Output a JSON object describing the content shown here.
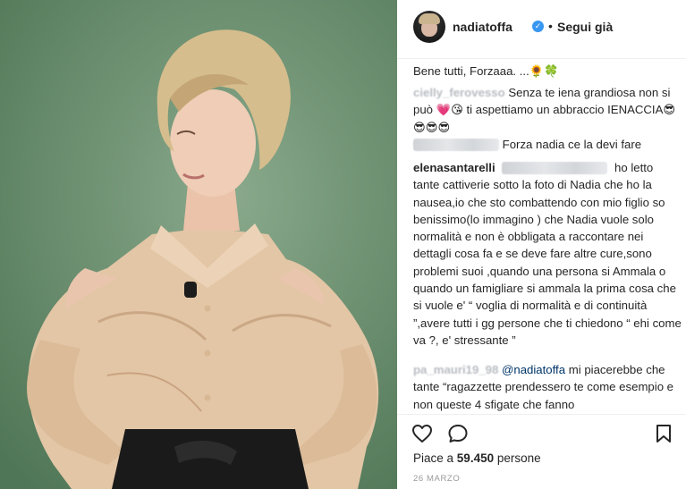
{
  "header": {
    "username": "nadiatoffa",
    "verified_glyph": "✓",
    "separator": "•",
    "follow_label": "Segui già"
  },
  "comments": [
    {
      "text": "Bene tutti, Forzaaa. ...🌻🍀"
    },
    {
      "user_hidden": "cielly_ferovesso",
      "text": "Senza te iena grandiosa non si può 💗😘 ti aspettiamo un abbraccio IENACCIA😎😎😎😎"
    },
    {
      "text": "Forza nadia ce la devi fare"
    },
    {
      "user": "elenasantarelli",
      "text": "ho letto tante cattiverie sotto la foto di Nadia che ho la nausea,io che sto combattendo con mio figlio so benissimo(lo immagino ) che Nadia vuole solo normalità e non è obbligata a raccontare nei dettagli cosa fa e se deve fare altre cure,sono problemi suoi ,quando una persona si Ammala o quando un famigliare si ammala la prima cosa che si vuole e' “ voglia di normalità e di continuità ”,avere tutti i gg persone che ti chiedono “ ehi come va ?, e' stressante ”"
    },
    {
      "user_hidden": "pa_mauri19_98",
      "mention": "@nadiatoffa",
      "text": "mi piacerebbe che tante “ragazzette prendessero te come esempio e non queste 4 sfigate che fanno"
    }
  ],
  "actions": {
    "like_icon": "heart-icon",
    "comment_icon": "comment-icon",
    "save_icon": "bookmark-icon"
  },
  "likes": {
    "prefix": "Piace a",
    "count": "59.450",
    "suffix": "persone"
  },
  "date": "26 MARZO",
  "colors": {
    "verified": "#3897f0",
    "text": "#262626",
    "muted": "#999999",
    "mention": "#003569",
    "photo_background": "#6f9273"
  }
}
